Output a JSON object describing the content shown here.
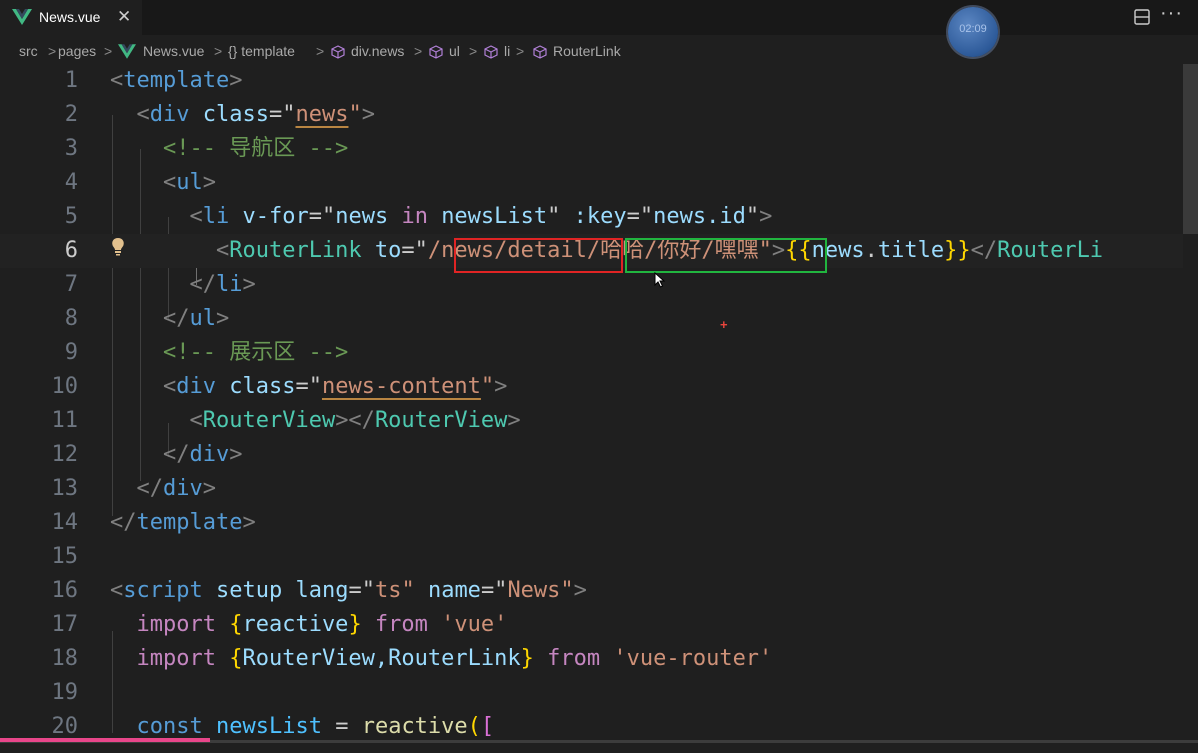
{
  "tab": {
    "label": "News.vue",
    "close": "✕"
  },
  "timer": {
    "value": "02:09"
  },
  "breadcrumb": {
    "items": [
      "src",
      "pages",
      "News.vue",
      "{} template",
      "div.news",
      "ul",
      "li",
      "RouterLink"
    ],
    "separator": ">"
  },
  "line_numbers": [
    "1",
    "2",
    "3",
    "4",
    "5",
    "6",
    "7",
    "8",
    "9",
    "10",
    "11",
    "12",
    "13",
    "14",
    "15",
    "16",
    "17",
    "18",
    "19",
    "20"
  ],
  "code": {
    "l1": {
      "open": "<",
      "tag": "template",
      "close": ">"
    },
    "l2": {
      "open": "<",
      "tag": "div",
      "attr": " class",
      "eq": "=\"",
      "val": "news",
      "q": "\"",
      "close": ">"
    },
    "l3": {
      "comment": "<!-- 导航区 -->"
    },
    "l4": {
      "open": "<",
      "tag": "ul",
      "close": ">"
    },
    "l5": {
      "open": "<",
      "tag": "li",
      "attr1": " v-for",
      "eq1": "=\"",
      "v1": "news",
      "kw": " in ",
      "v2": "newsList",
      "q1": "\"",
      "attr2": " :key",
      "eq2": "=\"",
      "v3": "news.id",
      "q2": "\"",
      "close": ">"
    },
    "l6": {
      "open": "<",
      "tag": "RouterLink",
      "attr": " to",
      "eq": "=\"",
      "path1": "/news/detail",
      "path2": "/哈哈/你好/嘿嘿",
      "q": "\"",
      "gt": ">",
      "b1": "{{",
      "v": "news",
      "dot": ".",
      "prop": "title",
      "b2": "}}",
      "end": "</",
      "endtag": "RouterLi"
    },
    "l7": {
      "open": "</",
      "tag": "li",
      "close": ">"
    },
    "l8": {
      "open": "</",
      "tag": "ul",
      "close": ">"
    },
    "l9": {
      "comment": "<!-- 展示区 -->"
    },
    "l10": {
      "open": "<",
      "tag": "div",
      "attr": " class",
      "eq": "=\"",
      "val": "news-content",
      "q": "\"",
      "close": ">"
    },
    "l11": {
      "open": "<",
      "tag": "RouterView",
      "mid": "></",
      "tag2": "RouterView",
      "close": ">"
    },
    "l12": {
      "open": "</",
      "tag": "div",
      "close": ">"
    },
    "l13": {
      "open": "</",
      "tag": "div",
      "close": ">"
    },
    "l14": {
      "open": "</",
      "tag": "template",
      "close": ">"
    },
    "l16": {
      "open": "<",
      "tag": "script",
      "a1": " setup",
      "a2": " lang",
      "eq": "=\"",
      "v1": "ts",
      "q": "\"",
      "a3": " name",
      "eq2": "=\"",
      "v2": "News",
      "q2": "\"",
      "close": ">"
    },
    "l17": {
      "kw": "import ",
      "b1": "{",
      "name": "reactive",
      "b2": "}",
      "from": " from ",
      "mod": "'vue'"
    },
    "l18": {
      "kw": "import ",
      "b1": "{",
      "name": "RouterView,RouterLink",
      "b2": "}",
      "from": " from ",
      "mod": "'vue-router'"
    },
    "l20": {
      "kw": "const ",
      "name": "newsList",
      "eq": " = ",
      "fn": "reactive",
      "p": "(",
      "b": "["
    }
  },
  "icons": [
    "vue-icon",
    "split-editor-icon",
    "more-actions-icon",
    "cube-icon",
    "lightbulb-icon",
    "mouse-cursor-icon"
  ],
  "colors": {
    "annotation_red": "#e02424",
    "annotation_green": "#21b53f",
    "editor_bg": "#1f1f1f"
  }
}
